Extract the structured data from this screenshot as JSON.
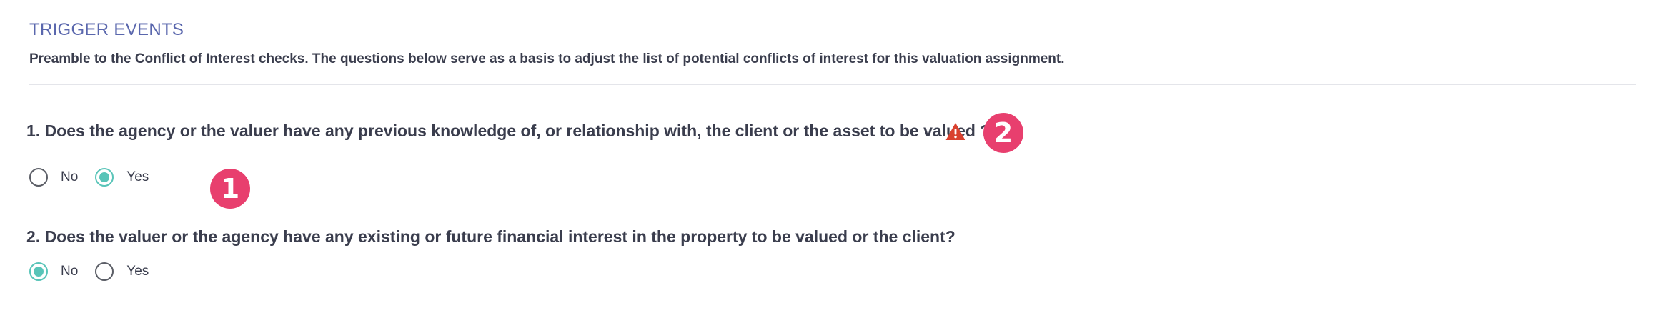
{
  "section": {
    "title": "TRIGGER EVENTS",
    "preamble": "Preamble to the Conflict of Interest checks. The questions below serve as a basis to adjust the list of potential conflicts of interest for this valuation assignment."
  },
  "questions": [
    {
      "text": "1. Does the agency or the valuer have any previous knowledge of, or relationship with, the client or the asset to be valued ?",
      "options": [
        "No",
        "Yes"
      ],
      "selected": "Yes",
      "warning_icon": "warning-triangle-icon"
    },
    {
      "text": "2. Does the valuer or the agency have any existing or future financial interest in the property to be valued or the client?",
      "options": [
        "No",
        "Yes"
      ],
      "selected": "No"
    }
  ],
  "annotations": {
    "badge_1": "1",
    "badge_2": "2"
  },
  "colors": {
    "title": "#5a67ad",
    "radio_checked": "#58c4b8",
    "warning": "#d9412f",
    "badge": "#e83f6e"
  }
}
